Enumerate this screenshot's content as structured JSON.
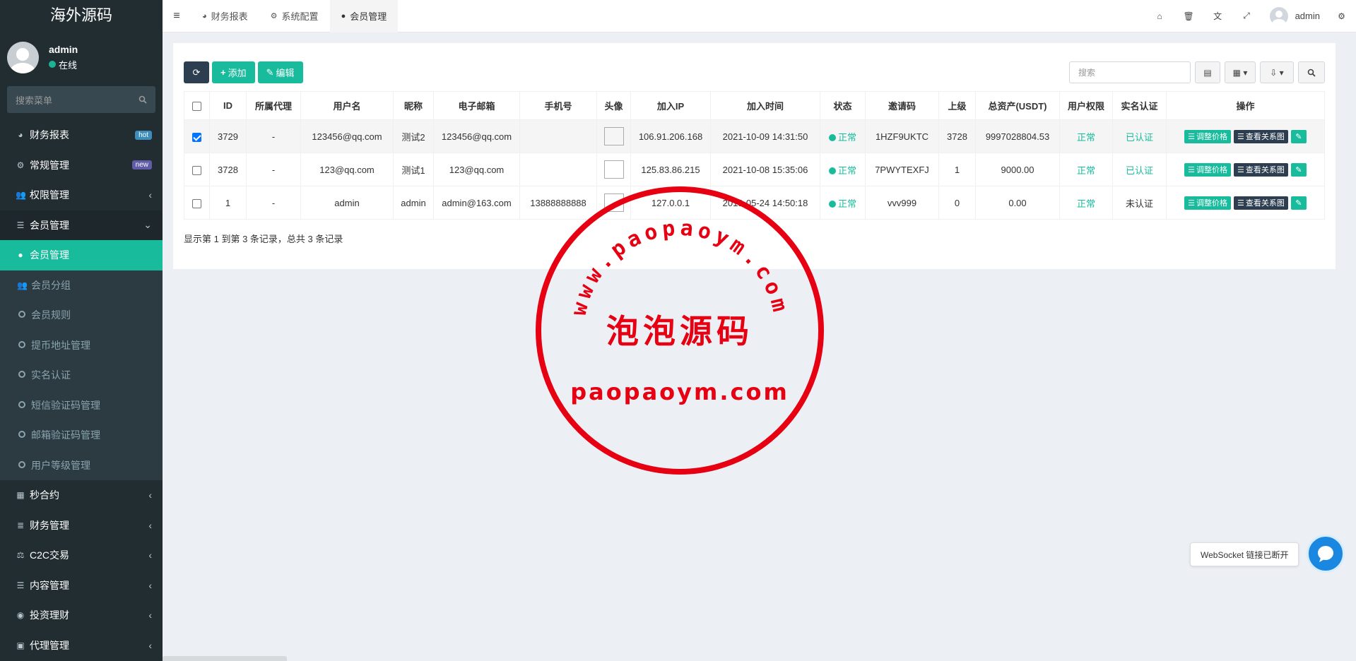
{
  "sidebar": {
    "logo": "海外源码",
    "user": {
      "name": "admin",
      "status": "在线"
    },
    "search_placeholder": "搜索菜单",
    "items": [
      {
        "label": "财务报表",
        "badge": "hot"
      },
      {
        "label": "常规管理",
        "badge": "new"
      },
      {
        "label": "权限管理"
      },
      {
        "label": "会员管理"
      },
      {
        "label": "会员管理"
      },
      {
        "label": "会员分组"
      },
      {
        "label": "会员规则"
      },
      {
        "label": "提币地址管理"
      },
      {
        "label": "实名认证"
      },
      {
        "label": "短信验证码管理"
      },
      {
        "label": "邮箱验证码管理"
      },
      {
        "label": "用户等级管理"
      },
      {
        "label": "秒合约"
      },
      {
        "label": "财务管理"
      },
      {
        "label": "C2C交易"
      },
      {
        "label": "内容管理"
      },
      {
        "label": "投资理财"
      },
      {
        "label": "代理管理"
      }
    ]
  },
  "topbar": {
    "tabs": [
      "财务报表",
      "系统配置",
      "会员管理"
    ],
    "user": "admin"
  },
  "toolbar": {
    "add": "添加",
    "edit": "编辑",
    "search_placeholder": "搜索"
  },
  "table": {
    "headers": [
      "ID",
      "所属代理",
      "用户名",
      "昵称",
      "电子邮箱",
      "手机号",
      "头像",
      "加入IP",
      "加入时间",
      "状态",
      "邀请码",
      "上级",
      "总资产(USDT)",
      "用户权限",
      "实名认证",
      "操作"
    ],
    "rows": [
      {
        "id": "3729",
        "agent": "-",
        "username": "123456@qq.com",
        "nickname": "测试2",
        "email": "123456@qq.com",
        "phone": "",
        "ip": "106.91.206.168",
        "time": "2021-10-09 14:31:50",
        "status": "正常",
        "invite": "1HZF9UKTC",
        "parent": "3728",
        "assets": "9997028804.53",
        "perm": "正常",
        "verify": "已认证"
      },
      {
        "id": "3728",
        "agent": "-",
        "username": "123@qq.com",
        "nickname": "测试1",
        "email": "123@qq.com",
        "phone": "",
        "ip": "125.83.86.215",
        "time": "2021-10-08 15:35:06",
        "status": "正常",
        "invite": "7PWYTEXFJ",
        "parent": "1",
        "assets": "9000.00",
        "perm": "正常",
        "verify": "已认证"
      },
      {
        "id": "1",
        "agent": "-",
        "username": "admin",
        "nickname": "admin",
        "email": "admin@163.com",
        "phone": "13888888888",
        "ip": "127.0.0.1",
        "time": "2019-05-24 14:50:18",
        "status": "正常",
        "invite": "vvv999",
        "parent": "0",
        "assets": "0.00",
        "perm": "正常",
        "verify": "未认证"
      }
    ],
    "op_adjust": "调整价格",
    "op_relation": "查看关系图"
  },
  "footer": "显示第 1 到第 3 条记录，总共 3 条记录",
  "stamp": {
    "arc": "www.paopaoym.com",
    "center": "泡泡源码",
    "bottom": "paopaoym.com"
  },
  "websocket": "WebSocket 链接已断开"
}
